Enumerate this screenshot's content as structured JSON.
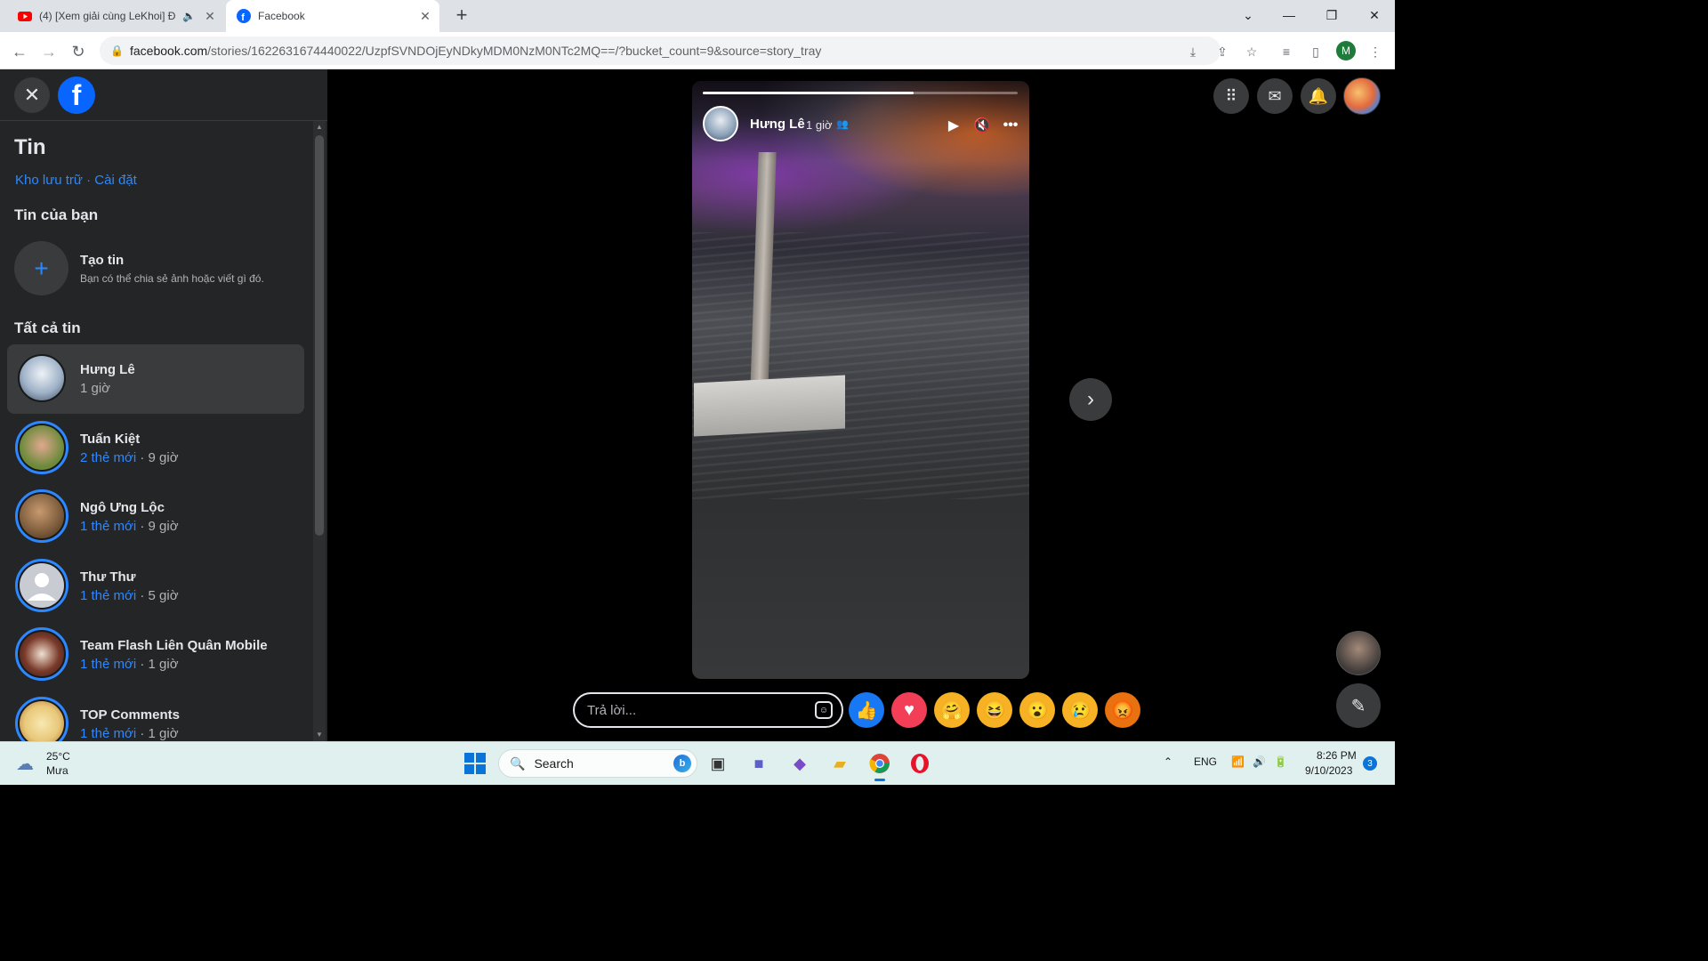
{
  "browser": {
    "tabs": [
      {
        "title": "(4) [Xem giải cùng LeKhoi] Đ",
        "favicon": "youtube-icon",
        "audio": true
      },
      {
        "title": "Facebook",
        "favicon": "facebook-icon",
        "active": true
      }
    ],
    "url_host": "facebook.com",
    "url_path": "/stories/1622631674440022/UzpfSVNDOjEyNDkyMDM0NzM0NTc2MQ==/?bucket_count=9&source=story_tray",
    "profile_initial": "M"
  },
  "sidebar": {
    "title": "Tin",
    "link_archive": "Kho lưu trữ",
    "link_sep": " · ",
    "link_settings": "Cài đặt",
    "your_stories_heading": "Tin của bạn",
    "create_title": "Tạo tin",
    "create_desc": "Bạn có thể chia sẻ ảnh hoặc viết gì đó.",
    "all_stories_heading": "Tất cả tin",
    "stories": [
      {
        "name": "Hưng Lê",
        "new": "",
        "time": "1 giờ",
        "selected": true,
        "color": "#c9d6e6"
      },
      {
        "name": "Tuấn Kiệt",
        "new": "2 thẻ mới",
        "time": " · 9 giờ",
        "color": "#6c8a3a"
      },
      {
        "name": "Ngô Ưng Lộc",
        "new": "1 thẻ mới",
        "time": " · 9 giờ",
        "color": "#7a5a3a"
      },
      {
        "name": "Thư Thư",
        "new": "1 thẻ mới",
        "time": " · 5 giờ",
        "color": "#c8ccd2"
      },
      {
        "name": "Team Flash Liên Quân Mobile",
        "new": "1 thẻ mới",
        "time": " · 1 giờ",
        "color": "#7a3a2a"
      },
      {
        "name": "TOP Comments",
        "new": "1 thẻ mới",
        "time": " · 1 giờ",
        "color": "#e8c87a"
      }
    ]
  },
  "viewer": {
    "author": "Hưng Lê",
    "time": "1 giờ",
    "progress": 0.67,
    "reply_placeholder": "Trả lời...",
    "reactions": [
      {
        "name": "like-reaction",
        "glyph": "👍",
        "bg": "#1877f2"
      },
      {
        "name": "love-reaction",
        "glyph": "♥",
        "bg": "#f33e58"
      },
      {
        "name": "care-reaction",
        "glyph": "🤗",
        "bg": "#f7b125"
      },
      {
        "name": "haha-reaction",
        "glyph": "😆",
        "bg": "#f7b125"
      },
      {
        "name": "wow-reaction",
        "glyph": "😮",
        "bg": "#f7b125"
      },
      {
        "name": "sad-reaction",
        "glyph": "😢",
        "bg": "#f7b125"
      },
      {
        "name": "angry-reaction",
        "glyph": "😡",
        "bg": "#e9710f"
      }
    ]
  },
  "taskbar": {
    "temp": "25°C",
    "weather": "Mưa",
    "search": "Search",
    "lang": "ENG",
    "time": "8:26 PM",
    "date": "9/10/2023",
    "notifications": "3"
  }
}
